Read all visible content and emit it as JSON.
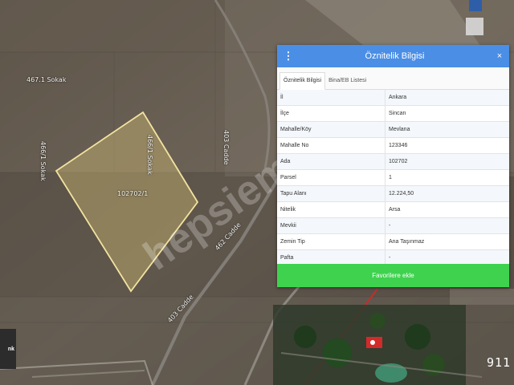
{
  "map": {
    "street_labels": [
      "467.1 Sokak",
      "466/1 Sokak",
      "466/1 Sokak",
      "403 Cadde",
      "462 Cadde",
      "403 Cadde"
    ],
    "parcel_label": "102702/1",
    "watermark": "hepsiemlak",
    "logo_text": "nk",
    "corner_number": "911"
  },
  "panel": {
    "title": "Öznitelik Bilgisi",
    "menu_icon": "⋮",
    "close_icon": "×",
    "tabs": [
      {
        "label": "Öznitelik Bilgisi",
        "active": true
      },
      {
        "label": "Bina/EB Listesi",
        "active": false
      }
    ],
    "rows": [
      {
        "key": "İl",
        "value": "Ankara"
      },
      {
        "key": "İlçe",
        "value": "Sincan"
      },
      {
        "key": "Mahalle/Köy",
        "value": "Mevlana"
      },
      {
        "key": "Mahalle No",
        "value": "123346"
      },
      {
        "key": "Ada",
        "value": "102702"
      },
      {
        "key": "Parsel",
        "value": "1"
      },
      {
        "key": "Tapu Alanı",
        "value": "12.224,50"
      },
      {
        "key": "Nitelik",
        "value": "Arsa"
      },
      {
        "key": "Mevkii",
        "value": "-"
      },
      {
        "key": "Zemin Tip",
        "value": "Ana Taşınmaz"
      },
      {
        "key": "Pafta",
        "value": "-"
      }
    ],
    "favorite_button": "Favorilere ekle"
  },
  "colors": {
    "header_blue": "#4a8ee6",
    "button_green": "#3fd24f",
    "parcel_outline": "#f3e3a0"
  }
}
